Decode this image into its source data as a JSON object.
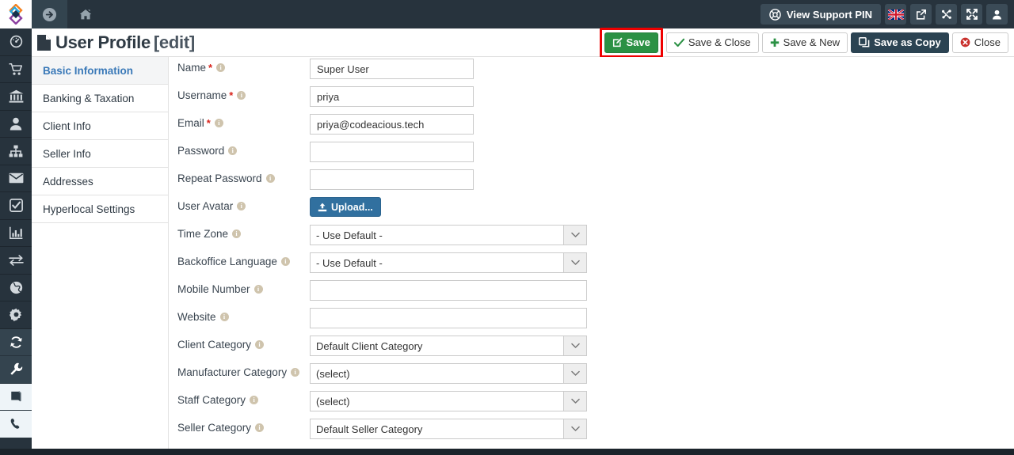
{
  "topbar": {
    "logo_icon": "diamond-logo-icon",
    "forward_icon": "arrow-circle-right-icon",
    "home_icon": "home-icon",
    "support_pin_label": "View Support PIN",
    "support_pin_icon": "lifebuoy-icon",
    "flag_icon": "uk-flag-icon",
    "external_link_icon": "external-link-icon",
    "joomla_icon": "joomla-icon",
    "fullscreen_icon": "fullscreen-icon",
    "user_icon": "user-icon"
  },
  "rail": {
    "items": [
      {
        "icon": "dashboard-icon",
        "style": "plain"
      },
      {
        "icon": "shopping-cart-icon",
        "style": "plain"
      },
      {
        "icon": "bank-icon",
        "style": "plain"
      },
      {
        "icon": "user-icon",
        "style": "plain"
      },
      {
        "icon": "sitemap-icon",
        "style": "plain"
      },
      {
        "icon": "envelope-icon",
        "style": "plain"
      },
      {
        "icon": "check-square-icon",
        "style": "plain"
      },
      {
        "icon": "bar-chart-icon",
        "style": "plain"
      },
      {
        "icon": "exchange-icon",
        "style": "plain"
      },
      {
        "icon": "globe-icon",
        "style": "plain"
      },
      {
        "icon": "gear-icon",
        "style": "plain"
      },
      {
        "icon": "refresh-icon",
        "style": "boxed"
      },
      {
        "icon": "wrench-icon",
        "style": "boxed"
      },
      {
        "icon": "book-icon",
        "style": "light"
      },
      {
        "icon": "phone-icon",
        "style": "light"
      }
    ]
  },
  "header": {
    "doc_icon": "file-icon",
    "title": "User Profile",
    "title_suffix": "[edit]",
    "actions": [
      {
        "label": "Save",
        "icon": "pencil-square-icon",
        "style": "green",
        "highlighted": true
      },
      {
        "label": "Save & Close",
        "icon": "check-icon",
        "style": "default",
        "highlighted": false
      },
      {
        "label": "Save & New",
        "icon": "plus-icon",
        "style": "default",
        "highlighted": false
      },
      {
        "label": "Save as Copy",
        "icon": "copy-icon",
        "style": "dark",
        "highlighted": false
      },
      {
        "label": "Close",
        "icon": "close-circle-icon",
        "style": "default",
        "highlighted": false
      }
    ]
  },
  "tabs": [
    {
      "label": "Basic Information",
      "active": true
    },
    {
      "label": "Banking & Taxation",
      "active": false
    },
    {
      "label": "Client Info",
      "active": false
    },
    {
      "label": "Seller Info",
      "active": false
    },
    {
      "label": "Addresses",
      "active": false
    },
    {
      "label": "Hyperlocal Settings",
      "active": false
    }
  ],
  "form": {
    "fields": [
      {
        "label": "Name",
        "required": true,
        "type": "text",
        "width": "w207",
        "value": "Super User",
        "placeholder": ""
      },
      {
        "label": "Username",
        "required": true,
        "type": "text",
        "width": "w207",
        "value": "priya",
        "placeholder": ""
      },
      {
        "label": "Email",
        "required": true,
        "type": "text",
        "width": "w207",
        "value": "priya@codeacious.tech",
        "placeholder": ""
      },
      {
        "label": "Password",
        "required": false,
        "type": "text",
        "width": "w207",
        "value": "",
        "placeholder": ""
      },
      {
        "label": "Repeat Password",
        "required": false,
        "type": "text",
        "width": "w207",
        "value": "",
        "placeholder": ""
      },
      {
        "label": "User Avatar",
        "required": false,
        "type": "upload",
        "width": "",
        "value": "Upload...",
        "placeholder": ""
      },
      {
        "label": "Time Zone",
        "required": false,
        "type": "select",
        "width": "w350",
        "value": "- Use Default -",
        "placeholder": ""
      },
      {
        "label": "Backoffice Language",
        "required": false,
        "type": "select",
        "width": "w350",
        "value": "- Use Default -",
        "placeholder": ""
      },
      {
        "label": "Mobile Number",
        "required": false,
        "type": "text",
        "width": "w350",
        "value": "",
        "placeholder": ""
      },
      {
        "label": "Website",
        "required": false,
        "type": "text",
        "width": "w350",
        "value": "",
        "placeholder": ""
      },
      {
        "label": "Client Category",
        "required": false,
        "type": "select",
        "width": "w350",
        "value": "Default Client Category",
        "placeholder": ""
      },
      {
        "label": "Manufacturer Category",
        "required": false,
        "type": "select",
        "width": "w350",
        "value": "(select)",
        "placeholder": ""
      },
      {
        "label": "Staff Category",
        "required": false,
        "type": "select",
        "width": "w350",
        "value": "(select)",
        "placeholder": ""
      },
      {
        "label": "Seller Category",
        "required": false,
        "type": "select",
        "width": "w350",
        "value": "Default Seller Category",
        "placeholder": ""
      }
    ]
  },
  "colors": {
    "topbar_bg": "#27333d",
    "accent_green": "#2b9144",
    "accent_dark": "#2b4352",
    "accent_blue": "#31709f",
    "highlight_red": "#ef0000",
    "tab_active_text": "#3a79b8"
  }
}
